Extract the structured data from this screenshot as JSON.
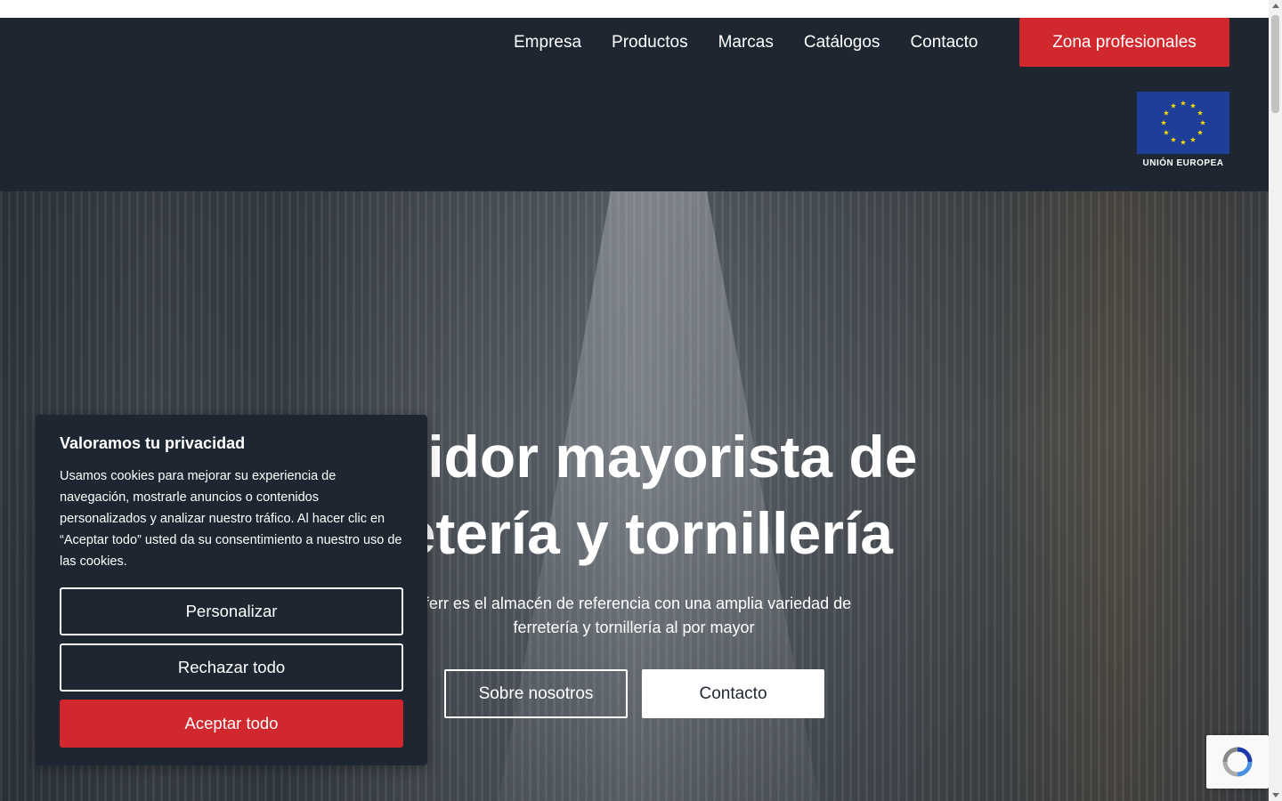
{
  "nav": {
    "items": [
      "Empresa",
      "Productos",
      "Marcas",
      "Catálogos",
      "Contacto"
    ],
    "pro_button": "Zona profesionales"
  },
  "eu_logo": {
    "caption": "UNIÓN EUROPEA",
    "icon": "eu-flag-icon"
  },
  "hero": {
    "title_line1": "buidor mayorista de",
    "title_line2": "retería y tornillería",
    "subtitle_line1": "yferr es el almacén de referencia con una amplia variedad de",
    "subtitle_line2": "ferretería y tornillería al por mayor",
    "btn_about": "Sobre nosotros",
    "btn_contact": "Contacto"
  },
  "cookie": {
    "title": "Valoramos tu privacidad",
    "body": "Usamos cookies para mejorar su experiencia de navegación, mostrarle anuncios o contenidos personalizados y analizar nuestro tráfico. Al hacer clic en “Aceptar todo” usted da su consentimiento a nuestro uso de las cookies.",
    "customize": "Personalizar",
    "reject": "Rechazar todo",
    "accept": "Aceptar todo"
  },
  "colors": {
    "header_bg": "#1e2731",
    "accent_red": "#d1282e",
    "eu_blue": "#1f3e97",
    "eu_star": "#ffdd00"
  }
}
